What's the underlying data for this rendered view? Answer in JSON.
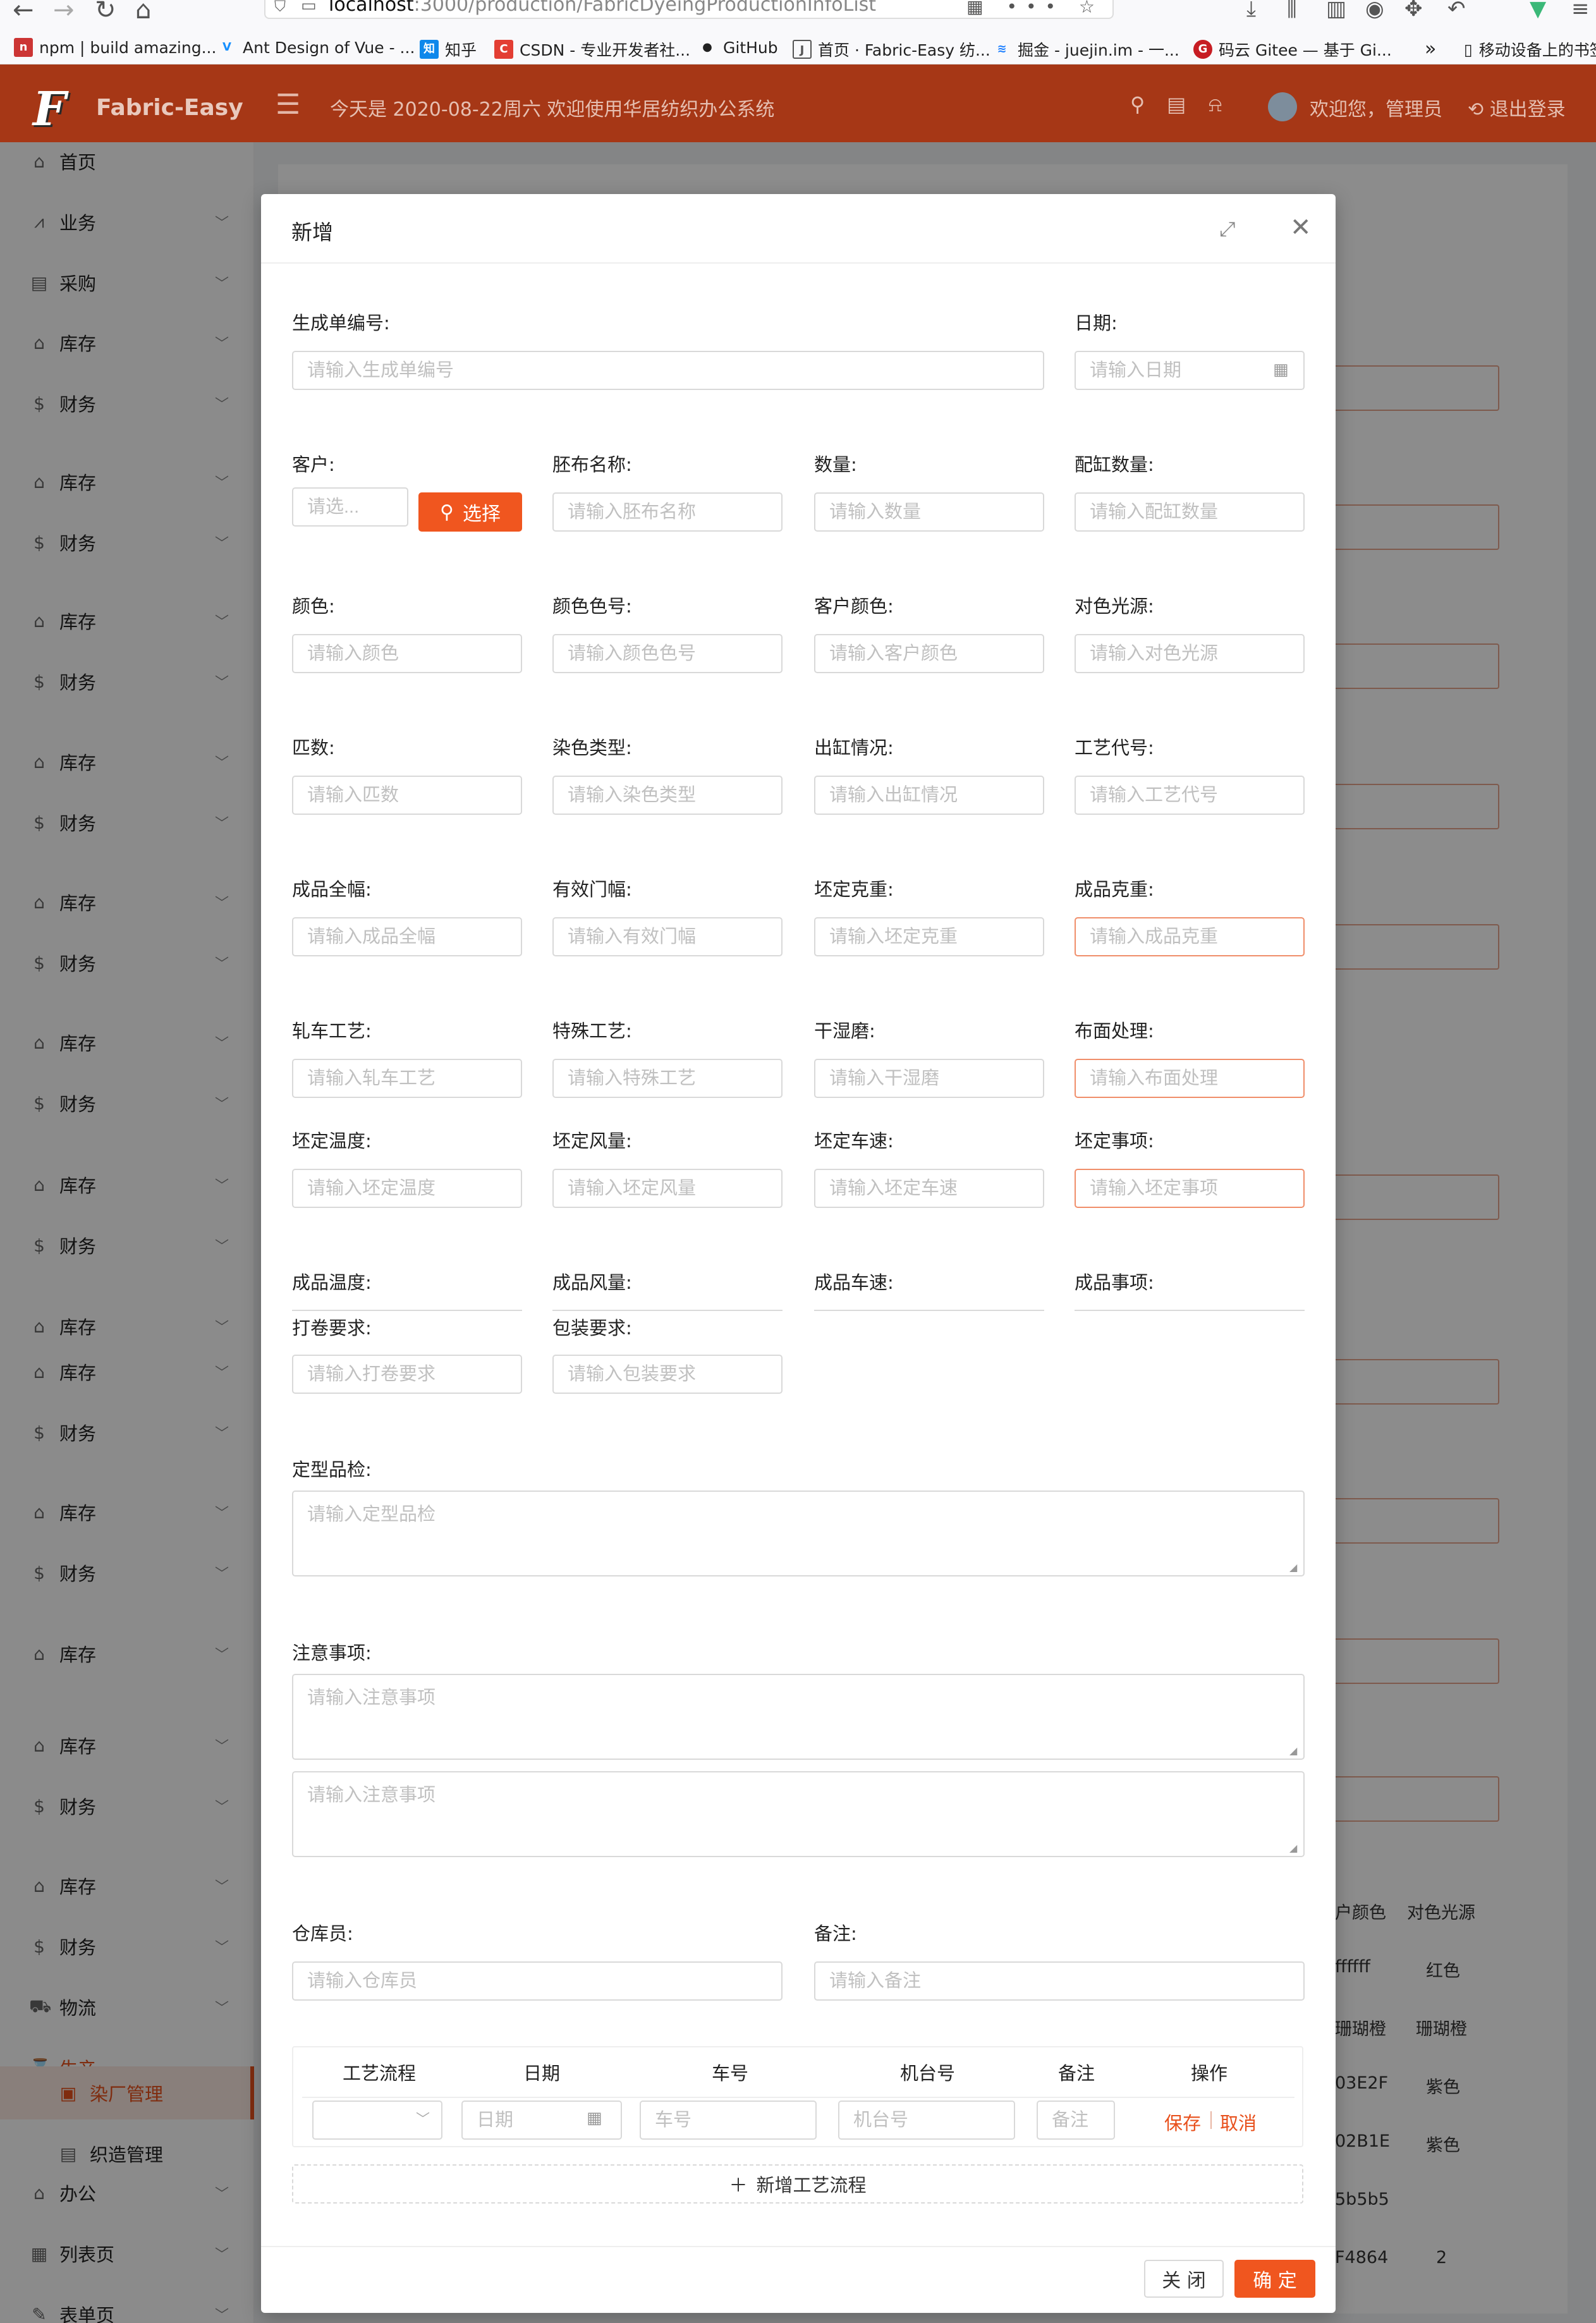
{
  "browser": {
    "url_host": "localhost",
    "url_rest": ":3000/production/FabricDyeingProductionInfoList",
    "bookmarks": [
      {
        "icon_text": "n",
        "icon_color": "#cc3534",
        "label": "npm | build amazing..."
      },
      {
        "icon_text": "V",
        "icon_color": "#1890ff",
        "label": "Ant Design of Vue - ..."
      },
      {
        "icon_text": "知",
        "icon_color": "#0f88eb",
        "label": "知乎"
      },
      {
        "icon_text": "C",
        "icon_color": "#e33e33",
        "label": "CSDN - 专业开发者社..."
      },
      {
        "icon_text": "●",
        "icon_color": "#222222",
        "label": "GitHub"
      },
      {
        "icon_text": "J",
        "icon_color": "#555555",
        "label": "首页 · Fabric-Easy 纺..."
      },
      {
        "icon_text": "≋",
        "icon_color": "#1e80ff",
        "label": "掘金 - juejin.im - 一..."
      },
      {
        "icon_text": "G",
        "icon_color": "#c71d23",
        "label": "码云 Gitee — 基于 Gi..."
      }
    ],
    "more_label": "»",
    "mobile_label": "移动设备上的书签"
  },
  "header": {
    "logo_mark": "F",
    "logo_text": "Fabric-Easy",
    "date_text": "今天是 2020-08-22周六 欢迎使用华居纺织办公系统",
    "welcome": "欢迎您，管理员",
    "logout": "退出登录"
  },
  "sidebar": {
    "items": [
      {
        "icon": "home-icon",
        "glyph": "⌂",
        "label": "首页",
        "arrow": false
      },
      {
        "icon": "chart-icon",
        "glyph": "⩘",
        "label": "业务",
        "arrow": true
      },
      {
        "icon": "purchase-icon",
        "glyph": "▤",
        "label": "采购",
        "arrow": true
      },
      {
        "icon": "home-icon",
        "glyph": "⌂",
        "label": "库存",
        "arrow": true
      },
      {
        "icon": "dollar-icon",
        "glyph": "$",
        "label": "财务",
        "arrow": true
      },
      {
        "icon": "home-icon",
        "glyph": "⌂",
        "label": "库存",
        "arrow": true
      },
      {
        "icon": "dollar-icon",
        "glyph": "$",
        "label": "财务",
        "arrow": true
      },
      {
        "icon": "home-icon",
        "glyph": "⌂",
        "label": "库存",
        "arrow": true
      },
      {
        "icon": "dollar-icon",
        "glyph": "$",
        "label": "财务",
        "arrow": true
      },
      {
        "icon": "home-icon",
        "glyph": "⌂",
        "label": "库存",
        "arrow": true
      },
      {
        "icon": "dollar-icon",
        "glyph": "$",
        "label": "财务",
        "arrow": true
      },
      {
        "icon": "home-icon",
        "glyph": "⌂",
        "label": "库存",
        "arrow": true
      },
      {
        "icon": "dollar-icon",
        "glyph": "$",
        "label": "财务",
        "arrow": true
      },
      {
        "icon": "home-icon",
        "glyph": "⌂",
        "label": "库存",
        "arrow": true
      },
      {
        "icon": "dollar-icon",
        "glyph": "$",
        "label": "财务",
        "arrow": true
      },
      {
        "icon": "home-icon",
        "glyph": "⌂",
        "label": "库存",
        "arrow": true
      },
      {
        "icon": "dollar-icon",
        "glyph": "$",
        "label": "财务",
        "arrow": true
      },
      {
        "icon": "home-icon",
        "glyph": "⌂",
        "label": "库存",
        "arrow": true
      },
      {
        "icon": "home-icon",
        "glyph": "⌂",
        "label": "库存",
        "arrow": true
      },
      {
        "icon": "dollar-icon",
        "glyph": "$",
        "label": "财务",
        "arrow": true
      },
      {
        "icon": "home-icon",
        "glyph": "⌂",
        "label": "库存",
        "arrow": true
      },
      {
        "icon": "dollar-icon",
        "glyph": "$",
        "label": "财务",
        "arrow": true
      },
      {
        "icon": "home-icon",
        "glyph": "⌂",
        "label": "库存",
        "arrow": true
      },
      {
        "icon": "home-icon",
        "glyph": "⌂",
        "label": "库存",
        "arrow": true
      },
      {
        "icon": "dollar-icon",
        "glyph": "$",
        "label": "财务",
        "arrow": true
      },
      {
        "icon": "home-icon",
        "glyph": "⌂",
        "label": "库存",
        "arrow": true
      },
      {
        "icon": "dollar-icon",
        "glyph": "$",
        "label": "财务",
        "arrow": true
      },
      {
        "icon": "truck-icon",
        "glyph": "⛟",
        "label": "物流",
        "arrow": true
      },
      {
        "icon": "hourglass-icon",
        "glyph": "⌛",
        "label": "生产",
        "arrow": true,
        "open": true
      },
      {
        "icon": "office-icon",
        "glyph": "⌂",
        "label": "办公",
        "arrow": true
      },
      {
        "icon": "table-icon",
        "glyph": "▦",
        "label": "列表页",
        "arrow": true
      },
      {
        "icon": "form-icon",
        "glyph": "✎",
        "label": "表单页",
        "arrow": true
      }
    ],
    "sub_items": [
      {
        "icon": "dyeing-icon",
        "glyph": "▣",
        "label": "染厂管理",
        "selected": true
      },
      {
        "icon": "weaving-icon",
        "glyph": "▤",
        "label": "织造管理",
        "selected": false
      }
    ]
  },
  "background_table": {
    "headers": [
      "户颜色",
      "对色光源"
    ],
    "rows": [
      [
        "ffffff",
        "红色"
      ],
      [
        "珊瑚橙",
        "珊瑚橙"
      ],
      [
        "03E2F",
        "紫色"
      ],
      [
        "02B1E",
        "紫色"
      ],
      [
        "5b5b5",
        ""
      ],
      [
        "F4864",
        "2"
      ]
    ]
  },
  "modal": {
    "title": "新增",
    "fields": {
      "order_no": {
        "label": "生成单编号:",
        "placeholder": "请输入生成单编号"
      },
      "date": {
        "label": "日期:",
        "placeholder": "请输入日期"
      },
      "customer": {
        "label": "客户:",
        "placeholder": "请选..."
      },
      "select_button": "选择",
      "grey_name": {
        "label": "胚布名称:",
        "placeholder": "请输入胚布名称"
      },
      "quantity": {
        "label": "数量:",
        "placeholder": "请输入数量"
      },
      "vat_qty": {
        "label": "配缸数量:",
        "placeholder": "请输入配缸数量"
      },
      "color": {
        "label": "颜色:",
        "placeholder": "请输入颜色"
      },
      "color_no": {
        "label": "颜色色号:",
        "placeholder": "请输入颜色色号"
      },
      "customer_color": {
        "label": "客户颜色:",
        "placeholder": "请输入客户颜色"
      },
      "light_source": {
        "label": "对色光源:",
        "placeholder": "请输入对色光源"
      },
      "pieces": {
        "label": "匹数:",
        "placeholder": "请输入匹数"
      },
      "dye_type": {
        "label": "染色类型:",
        "placeholder": "请输入染色类型"
      },
      "vat_out": {
        "label": "出缸情况:",
        "placeholder": "请输入出缸情况"
      },
      "craft_code": {
        "label": "工艺代号:",
        "placeholder": "请输入工艺代号"
      },
      "full_width": {
        "label": "成品全幅:",
        "placeholder": "请输入成品全幅"
      },
      "effective_width": {
        "label": "有效门幅:",
        "placeholder": "请输入有效门幅"
      },
      "blank_weight": {
        "label": "坯定克重:",
        "placeholder": "请输入坯定克重"
      },
      "finished_weight": {
        "label": "成品克重:",
        "placeholder": "请输入成品克重"
      },
      "rolling": {
        "label": "轧车工艺:",
        "placeholder": "请输入轧车工艺"
      },
      "special": {
        "label": "特殊工艺:",
        "placeholder": "请输入特殊工艺"
      },
      "dry_wet": {
        "label": "干湿磨:",
        "placeholder": "请输入干湿磨"
      },
      "surface": {
        "label": "布面处理:",
        "placeholder": "请输入布面处理"
      },
      "set_temp": {
        "label": "坯定温度:",
        "placeholder": "请输入坯定温度"
      },
      "set_wind": {
        "label": "坯定风量:",
        "placeholder": "请输入坯定风量"
      },
      "set_speed": {
        "label": "坯定车速:",
        "placeholder": "请输入坯定车速"
      },
      "set_notes": {
        "label": "坯定事项:",
        "placeholder": "请输入坯定事项"
      },
      "fin_temp": {
        "label": "成品温度:"
      },
      "fin_wind": {
        "label": "成品风量:"
      },
      "fin_speed": {
        "label": "成品车速:"
      },
      "fin_notes": {
        "label": "成品事项:"
      },
      "roll_req": {
        "label": "打卷要求:",
        "placeholder": "请输入打卷要求"
      },
      "pack_req": {
        "label": "包装要求:",
        "placeholder": "请输入包装要求"
      },
      "setting_qc": {
        "label": "定型品检:",
        "placeholder": "请输入定型品检"
      },
      "notes": {
        "label": "注意事项:",
        "placeholder": "请输入注意事项"
      },
      "notes2": {
        "placeholder": "请输入注意事项"
      },
      "keeper": {
        "label": "仓库员:",
        "placeholder": "请输入仓库员"
      },
      "remark": {
        "label": "备注:",
        "placeholder": "请输入备注"
      }
    },
    "process_table": {
      "headers": [
        "工艺流程",
        "日期",
        "车号",
        "机台号",
        "备注",
        "操作"
      ],
      "row": {
        "process_value": "",
        "date_placeholder": "日期",
        "car_placeholder": "车号",
        "machine_placeholder": "机台号",
        "remark_placeholder": "备注",
        "save": "保存",
        "cancel": "取消"
      },
      "add_label": "新增工艺流程"
    },
    "footer": {
      "close": "关 闭",
      "confirm": "确 定"
    }
  }
}
